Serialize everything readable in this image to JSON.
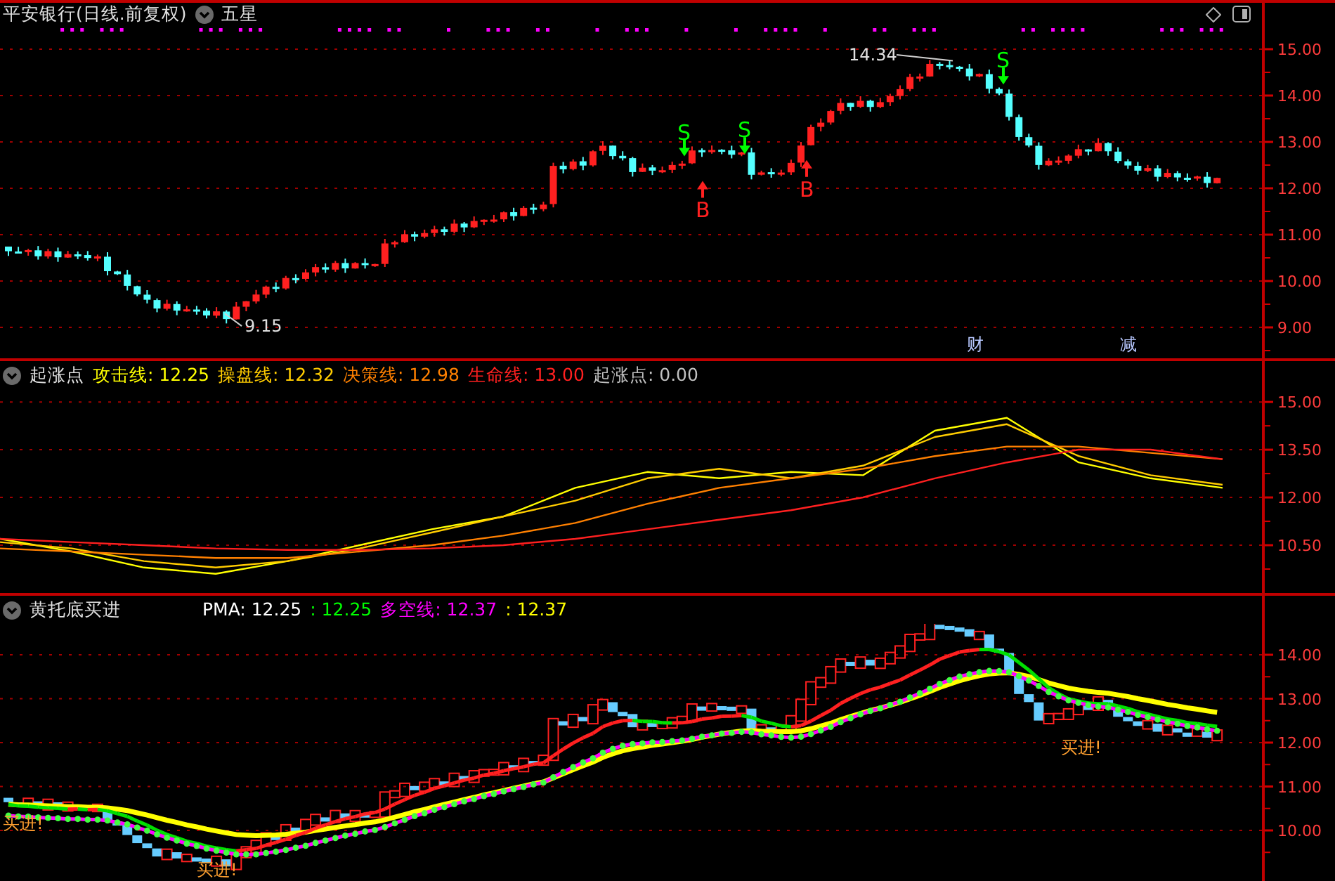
{
  "panels": [
    {
      "kind": "price",
      "title": "平安银行(日线.前复权)",
      "indicator": "五星",
      "axis_labels": [
        "15.00",
        "14.00",
        "13.00",
        "12.00",
        "11.00",
        "10.00",
        "9.00"
      ],
      "markers": [
        {
          "kind": "low",
          "text": "9.15"
        },
        {
          "kind": "high",
          "text": "14.34"
        }
      ],
      "signals": [
        {
          "kind": "sell",
          "text": "S"
        },
        {
          "kind": "buy",
          "text": "B"
        },
        {
          "kind": "sell",
          "text": "S"
        },
        {
          "kind": "buy",
          "text": "B"
        },
        {
          "kind": "sell",
          "text": "S"
        }
      ],
      "events": [
        "财",
        "减"
      ]
    },
    {
      "kind": "lines",
      "title": "起涨点",
      "legend_values": [
        ": 12.25",
        ": 12.32",
        ": 12.98",
        ": 13.00"
      ],
      "extra_legend": {
        "text": "起涨点: 0.00",
        "color": "#c0c0c0"
      },
      "chart_data": {
        "type": "line",
        "grid": true,
        "ylim": [
          9.0,
          15.4
        ],
        "yticks": [
          {
            "value": 15,
            "label": "15.00"
          },
          {
            "value": 13.5,
            "label": "13.50"
          },
          {
            "value": 12,
            "label": "12.00"
          },
          {
            "value": 10.5,
            "label": "10.50"
          }
        ],
        "series": [
          {
            "name": "攻击线",
            "color": "#ffff00",
            "values": [
              10.7,
              10.3,
              9.8,
              9.6,
              10.0,
              10.5,
              11.0,
              11.4,
              12.3,
              12.8,
              12.6,
              12.8,
              12.7,
              14.1,
              14.5,
              13.1,
              12.6,
              12.3
            ]
          },
          {
            "name": "操盘线",
            "color": "#ffcc00",
            "values": [
              10.6,
              10.4,
              10.0,
              9.8,
              10.0,
              10.4,
              10.9,
              11.4,
              11.9,
              12.6,
              12.9,
              12.6,
              13.0,
              13.9,
              14.3,
              13.3,
              12.7,
              12.4
            ]
          },
          {
            "name": "决策线",
            "color": "#ff8000",
            "values": [
              10.4,
              10.3,
              10.2,
              10.1,
              10.1,
              10.3,
              10.5,
              10.8,
              11.2,
              11.8,
              12.3,
              12.6,
              12.9,
              13.3,
              13.6,
              13.6,
              13.4,
              13.2
            ]
          },
          {
            "name": "生命线",
            "color": "#ff2020",
            "values": [
              10.7,
              10.6,
              10.5,
              10.4,
              10.35,
              10.35,
              10.4,
              10.5,
              10.7,
              11.0,
              11.3,
              11.6,
              12.0,
              12.6,
              13.1,
              13.5,
              13.5,
              13.2
            ]
          }
        ]
      }
    },
    {
      "kind": "buy_signal",
      "title": "黄托底买进",
      "legend": [
        {
          "text": "PMA: 12.25",
          "color": "#ffffff"
        },
        {
          "text": ": 12.25",
          "color": "#00ff00"
        },
        {
          "text": "多空线: 12.37",
          "color": "#ff00ff"
        },
        {
          "text": ": 12.37",
          "color": "#ffff00"
        }
      ],
      "axis_labels": [
        "14.00",
        "13.00",
        "12.00",
        "11.00",
        "10.00"
      ],
      "labels": [
        "买进!",
        "买进!",
        "买进!"
      ]
    }
  ]
}
